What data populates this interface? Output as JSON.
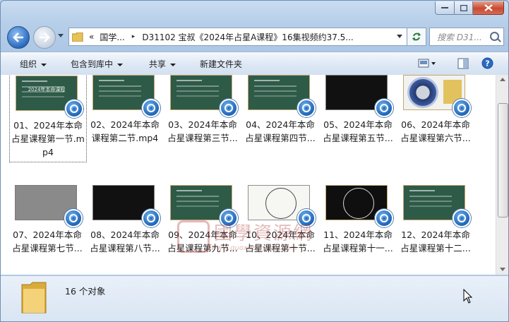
{
  "address": {
    "chevrons": "«",
    "crumbs": [
      "国学...",
      "D31102 宝叔《2024年占星A课程》16集视频约37.5..."
    ],
    "separator": "▸"
  },
  "search": {
    "placeholder": "搜索 D31..."
  },
  "toolbar": {
    "organize": "组织",
    "include_library": "包含到库中",
    "share": "共享",
    "new_folder": "新建文件夹"
  },
  "files": [
    {
      "label": "01、2024年本命占星课程第一节.mp4",
      "thumb": "board",
      "thumb_title": "2024年本命课程"
    },
    {
      "label": "02、2024年本命课程第二节.mp4",
      "thumb": "board",
      "thumb_title": ""
    },
    {
      "label": "03、2024年本命占星课程第三节...",
      "thumb": "board",
      "thumb_title": ""
    },
    {
      "label": "04、2024年本命占星课程第四节...",
      "thumb": "board",
      "thumb_title": ""
    },
    {
      "label": "05、2024年本命占星课程第五节...",
      "thumb": "dark",
      "thumb_title": ""
    },
    {
      "label": "06、2024年本命占星课程第六节...",
      "thumb": "wheel",
      "thumb_title": ""
    },
    {
      "label": "07、2024年本命占星课程第七节...",
      "thumb": "grey",
      "thumb_title": ""
    },
    {
      "label": "08、2024年本命占星课程第八节...",
      "thumb": "dark",
      "thumb_title": ""
    },
    {
      "label": "09、2024年本命占星课程第九节...",
      "thumb": "board",
      "thumb_title": ""
    },
    {
      "label": "10、2024年本命占星课程第十节...",
      "thumb": "chart",
      "thumb_title": ""
    },
    {
      "label": "11、2024年本命占星课程第十一...",
      "thumb": "chartdark",
      "thumb_title": ""
    },
    {
      "label": "12、2024年本命占星课程第十二...",
      "thumb": "board",
      "thumb_title": ""
    }
  ],
  "status": {
    "count_text": "16 个对象"
  },
  "watermark": {
    "line1": "國學資源網",
    "line2": "www.guoxueziyuan.com"
  },
  "colors": {
    "accent": "#2a6bc0",
    "window_frame": "#adc7e6",
    "close": "#c74a31"
  },
  "icons": [
    "back-arrow-icon",
    "forward-arrow-icon",
    "folder-icon",
    "refresh-icon",
    "search-icon",
    "view-icon",
    "preview-pane-icon",
    "help-icon",
    "video-badge-icon",
    "mouse-cursor-icon"
  ]
}
